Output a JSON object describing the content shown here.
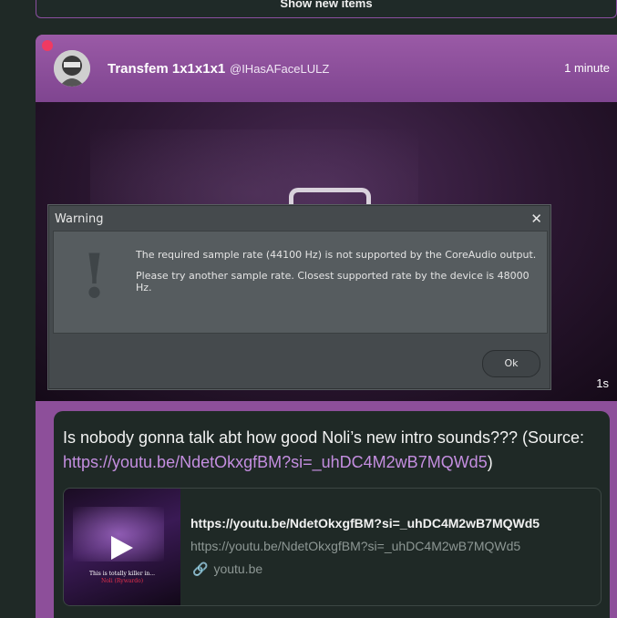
{
  "top_bar": {
    "show_new_label": "Show new items"
  },
  "post": {
    "author_name": "Transfem 1x1x1x1",
    "author_handle": "@IHasAFaceLULZ",
    "timestamp": "1 minute",
    "media_duration": "1s",
    "text_prefix": "Is nobody gonna talk abt how good Noli’s new intro sounds??? (Source: ",
    "link_url": "https://youtu.be/NdetOkxgfBM?si=_uhDC4M2wB7MQWd5",
    "text_suffix": ")",
    "link_card": {
      "title": "https://youtu.be/NdetOkxgfBM?si=_uhDC4M2wB7MQWd5",
      "description": "https://youtu.be/NdetOkxgfBM?si=_uhDC4M2wB7MQWd5",
      "domain": "youtu.be",
      "thumb_caption_1": "This is totally killer in...",
      "thumb_caption_2": "Noli (Rywardo)"
    }
  },
  "dialog": {
    "title": "Warning",
    "close_glyph": "✕",
    "icon_glyph": "!",
    "message_line1": "The required sample rate (44100 Hz) is not supported by the CoreAudio output.",
    "message_line2": "Please try another sample rate. Closest supported rate by the device is 48000 Hz.",
    "ok_label": "Ok"
  },
  "colors": {
    "background": "#1f2926",
    "card_purple": "#8d4f9a",
    "unread_dot": "#f03a62",
    "link": "#c48ee0"
  },
  "icons": [
    "close-icon",
    "warning-icon",
    "play-icon",
    "link-icon"
  ]
}
